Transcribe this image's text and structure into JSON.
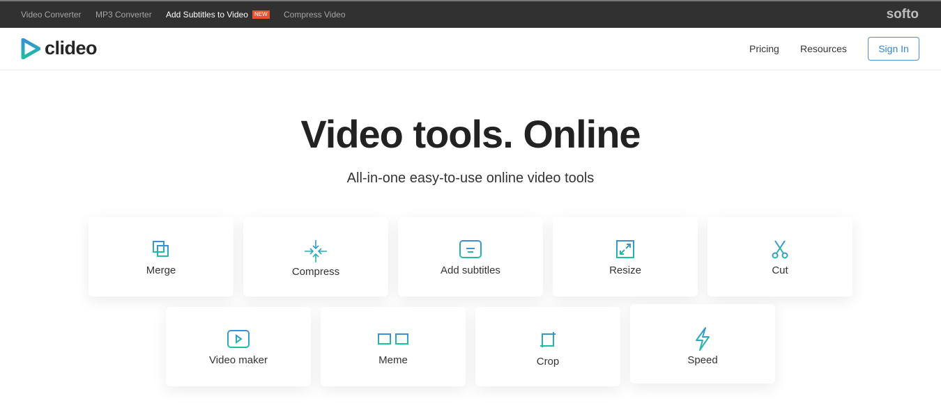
{
  "topbar": {
    "links": [
      "Video Converter",
      "MP3 Converter",
      "Add Subtitles to Video",
      "Compress Video"
    ],
    "new_badge": "NEW",
    "brand": "softo"
  },
  "header": {
    "logo": "clideo",
    "nav": [
      "Pricing",
      "Resources"
    ],
    "sign_in": "Sign In"
  },
  "hero": {
    "title": "Video tools. Online",
    "subtitle": "All-in-one easy-to-use online video tools"
  },
  "tools": [
    {
      "label": "Merge",
      "icon": "merge-icon"
    },
    {
      "label": "Compress",
      "icon": "compress-icon"
    },
    {
      "label": "Add subtitles",
      "icon": "subtitles-icon"
    },
    {
      "label": "Resize",
      "icon": "resize-icon"
    },
    {
      "label": "Cut",
      "icon": "scissors-icon"
    },
    {
      "label": "Video maker",
      "icon": "play-icon"
    },
    {
      "label": "Meme",
      "icon": "glasses-icon"
    },
    {
      "label": "Crop",
      "icon": "crop-icon"
    },
    {
      "label": "Speed",
      "icon": "lightning-icon"
    }
  ],
  "colors": {
    "accent": "#2e86d1",
    "icon_from": "#3a8fd6",
    "icon_to": "#1fbf9f"
  }
}
